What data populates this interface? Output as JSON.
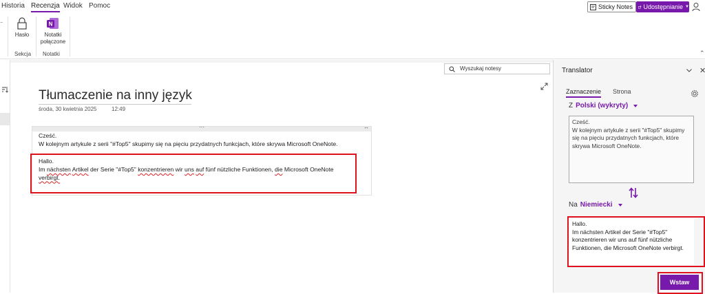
{
  "ribbon_tabs": [
    {
      "label": "Historia"
    },
    {
      "label": "Recenzja",
      "active": true
    },
    {
      "label": "Widok"
    },
    {
      "label": "Pomoc"
    }
  ],
  "top_buttons": {
    "sticky_notes": "Sticky Notes",
    "share": "Udostępnianie"
  },
  "ribbon": {
    "password_label": "Hasło",
    "linked_notes_label": "Notatki połączone",
    "groups": [
      "Sekcja",
      "Notatki"
    ]
  },
  "search": {
    "placeholder": "Wyszukaj notesy"
  },
  "page": {
    "title": "Tłumaczenie na inny język",
    "date": "środa, 30 kwietnia 2025",
    "time": "12:49",
    "source_lines": [
      "Cześć.",
      "W kolejnym artykule z serii \"#Top5\" skupimy się na pięciu przydatnych funkcjach, które skrywa Microsoft OneNote."
    ],
    "translated_line1": "Hallo.",
    "translated_words": [
      "Im",
      "nächsten",
      "Artikel",
      "der",
      "Serie",
      "\"#Top5\"",
      "konzentrieren",
      "wir",
      "uns",
      "auf",
      "fünf",
      "nützliche",
      "Funktionen,",
      "die",
      "Microsoft",
      "OneNote",
      "verbirgt."
    ]
  },
  "translator": {
    "title": "Translator",
    "tabs": [
      {
        "label": "Zaznaczenie",
        "active": true
      },
      {
        "label": "Strona"
      }
    ],
    "from_prefix": "Z",
    "from_lang": "Polski (wykryty)",
    "to_prefix": "Na",
    "to_lang": "Niemiecki",
    "source_text": "Cześć.\nW kolejnym artykule z serii \"#Top5\" skupimy się na pięciu przydatnych funkcjach, które skrywa Microsoft OneNote.",
    "result_text": "Hallo.\nIm nächsten Artikel der Serie \"#Top5\" konzentrieren wir uns auf fünf nützliche Funktionen, die Microsoft OneNote verbirgt.",
    "insert_label": "Wstaw"
  },
  "colors": {
    "accent": "#7719aa",
    "highlight": "#e0101e"
  }
}
